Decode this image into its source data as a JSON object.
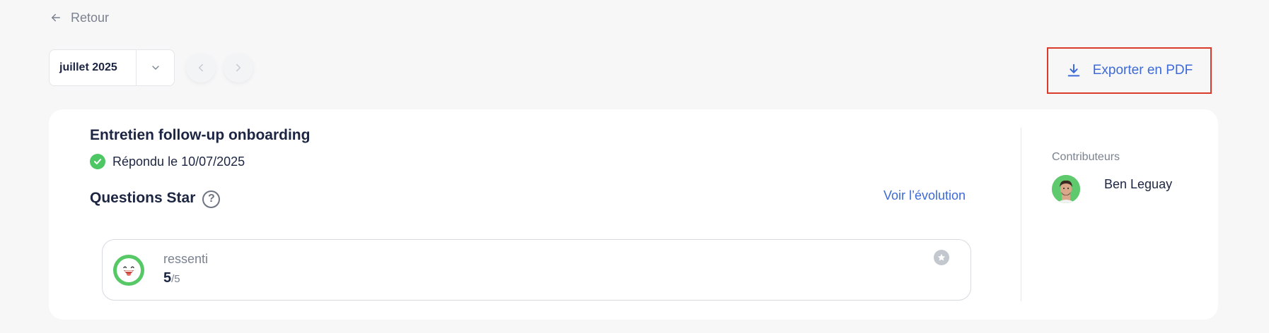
{
  "back": {
    "label": "Retour"
  },
  "period": {
    "selected": "juillet 2025"
  },
  "toolbar": {
    "export_label": "Exporter en PDF"
  },
  "interview": {
    "title": "Entretien follow-up onboarding",
    "status": "Répondu le 10/07/2025",
    "section_title": "Questions Star",
    "evolution_link": "Voir l’évolution",
    "questions": [
      {
        "label": "ressenti",
        "score": "5",
        "max": "/5"
      }
    ]
  },
  "contributors": {
    "label": "Contributeurs",
    "items": [
      {
        "name": "Ben Leguay"
      }
    ]
  },
  "colors": {
    "accent": "#3d6ad6",
    "success": "#4cc764",
    "highlight_border": "#d93a2b"
  }
}
